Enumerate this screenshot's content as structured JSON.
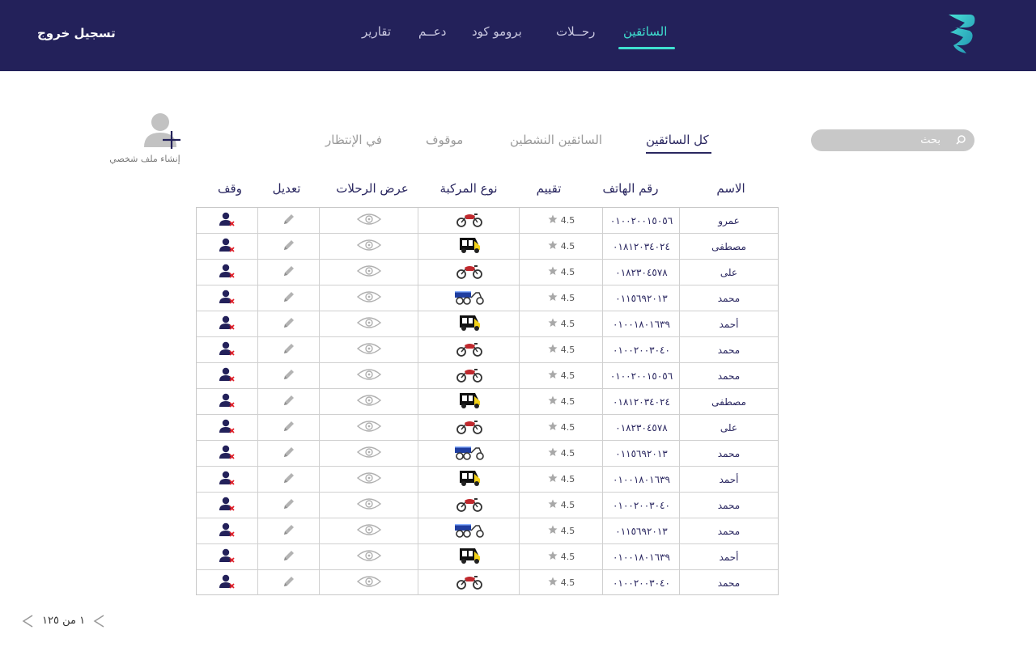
{
  "header": {
    "nav": [
      {
        "label": "السائقين",
        "active": true
      },
      {
        "label": "رحــلات",
        "active": false
      },
      {
        "label": "برومو كود",
        "active": false
      },
      {
        "label": "دعــم",
        "active": false
      },
      {
        "label": "تقارير",
        "active": false
      }
    ],
    "logout_label": "تسجيل خروج",
    "logo_icon": "brand-logo-icon",
    "colors": {
      "bar": "#23215a",
      "accent": "#3fe0d0"
    }
  },
  "toolbar": {
    "search_placeholder": "بحث",
    "filter_tabs": [
      {
        "label": "كل السائقين",
        "active": true
      },
      {
        "label": "السائقين النشطين",
        "active": false
      },
      {
        "label": "موقوف",
        "active": false
      },
      {
        "label": "في الإنتظار",
        "active": false
      }
    ],
    "create_profile_label": "إنشاء ملف شخصي"
  },
  "table": {
    "headers": {
      "name": "الاسم",
      "phone": "رقم الهاتف",
      "rating": "تقييم",
      "vehicle": "نوع المركبة",
      "trips": "عرض الرحلات",
      "edit": "تعديل",
      "stop": "وقف"
    },
    "rows": [
      {
        "name": "عمرو",
        "phone": "٠١٠٠٢٠٠١٥٠٥٦",
        "rating": "4.5",
        "vehicle": "motorcycle"
      },
      {
        "name": "مصطفى",
        "phone": "٠١٨١٢٠٣٤٠٢٤",
        "rating": "4.5",
        "vehicle": "tuktuk"
      },
      {
        "name": "على",
        "phone": "٠١٨٢٣٠٤٥٧٨",
        "rating": "4.5",
        "vehicle": "motorcycle"
      },
      {
        "name": "محمد",
        "phone": "٠١١٥٦٩٢٠١٣",
        "rating": "4.5",
        "vehicle": "cargo-tricycle"
      },
      {
        "name": "أحمد",
        "phone": "٠١٠٠١٨٠١٦٣٩",
        "rating": "4.5",
        "vehicle": "tuktuk"
      },
      {
        "name": "محمد",
        "phone": "٠١٠٠٢٠٠٣٠٤٠",
        "rating": "4.5",
        "vehicle": "motorcycle"
      },
      {
        "name": "محمد",
        "phone": "٠١٠٠٢٠٠١٥٠٥٦",
        "rating": "4.5",
        "vehicle": "motorcycle"
      },
      {
        "name": "مصطفى",
        "phone": "٠١٨١٢٠٣٤٠٢٤",
        "rating": "4.5",
        "vehicle": "tuktuk"
      },
      {
        "name": "على",
        "phone": "٠١٨٢٣٠٤٥٧٨",
        "rating": "4.5",
        "vehicle": "motorcycle"
      },
      {
        "name": "محمد",
        "phone": "٠١١٥٦٩٢٠١٣",
        "rating": "4.5",
        "vehicle": "cargo-tricycle"
      },
      {
        "name": "أحمد",
        "phone": "٠١٠٠١٨٠١٦٣٩",
        "rating": "4.5",
        "vehicle": "tuktuk"
      },
      {
        "name": "محمد",
        "phone": "٠١٠٠٢٠٠٣٠٤٠",
        "rating": "4.5",
        "vehicle": "motorcycle"
      },
      {
        "name": "محمد",
        "phone": "٠١١٥٦٩٢٠١٣",
        "rating": "4.5",
        "vehicle": "cargo-tricycle"
      },
      {
        "name": "أحمد",
        "phone": "٠١٠٠١٨٠١٦٣٩",
        "rating": "4.5",
        "vehicle": "tuktuk"
      },
      {
        "name": "محمد",
        "phone": "٠١٠٠٢٠٠٣٠٤٠",
        "rating": "4.5",
        "vehicle": "motorcycle"
      }
    ]
  },
  "pagination": {
    "label": "١ من ١٢٥"
  }
}
